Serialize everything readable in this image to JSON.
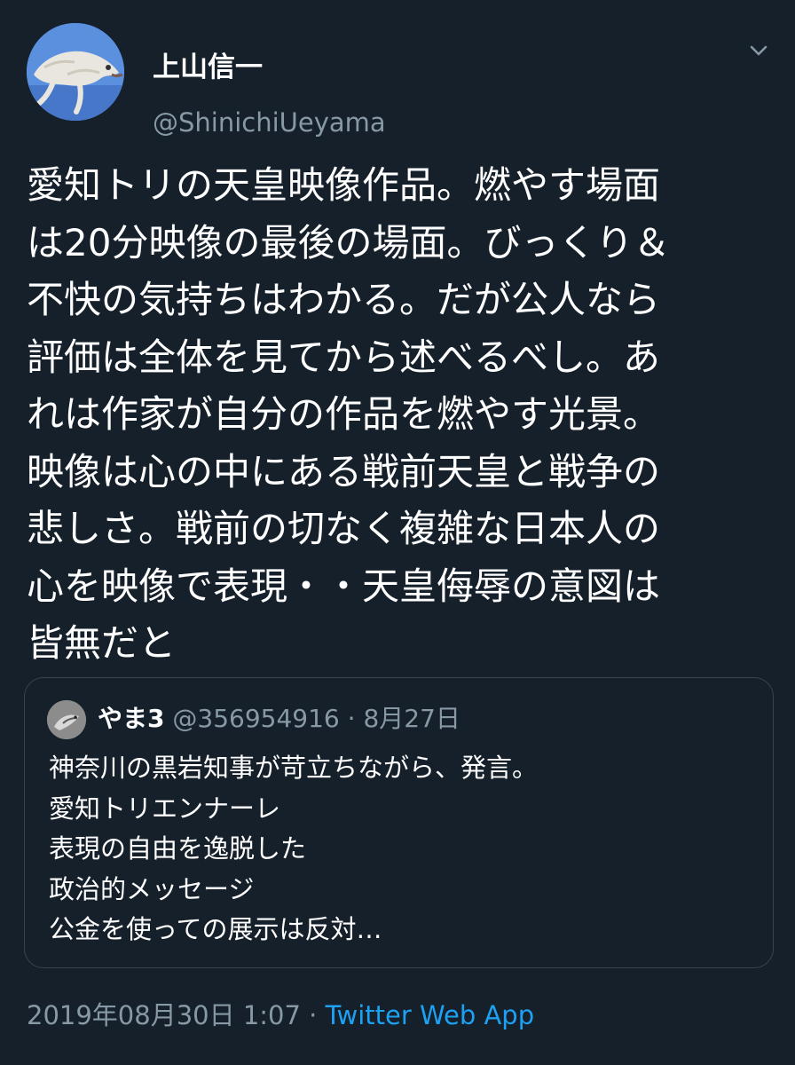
{
  "author": {
    "display_name": "上山信一",
    "handle": "@ShinichiUeyama"
  },
  "icons": {
    "avatar": "dog-avatar-image",
    "menu": "chevron-down-icon",
    "quote_avatar": "bird-avatar-image"
  },
  "tweet": {
    "lines": [
      "愛知トリの天皇映像作品。燃やす場面",
      "は20分映像の最後の場面。びっくり＆",
      "不快の気持ちはわかる。だが公人なら",
      "評価は全体を見てから述べるべし。あ",
      "れは作家が自分の作品を燃やす光景。",
      "映像は心の中にある戦前天皇と戦争の",
      "悲しさ。戦前の切なく複雑な日本人の",
      "心を映像で表現・・天皇侮辱の意図は",
      "皆無だと"
    ]
  },
  "quote": {
    "name": "やま3",
    "handle": "@356954916",
    "separator": "·",
    "date": "8月27日",
    "lines": [
      "神奈川の黒岩知事が苛立ちながら、発言。",
      "愛知トリエンナーレ",
      "表現の自由を逸脱した",
      "政治的メッセージ",
      "公金を使っての展示は反対…"
    ]
  },
  "footer": {
    "timestamp": "2019年08月30日 1:07",
    "separator": "·",
    "app": "Twitter Web App"
  },
  "colors": {
    "background": "#15202b",
    "text": "#ffffff",
    "secondary": "#8899a6",
    "link": "#1da1f2",
    "border": "#38444d"
  }
}
